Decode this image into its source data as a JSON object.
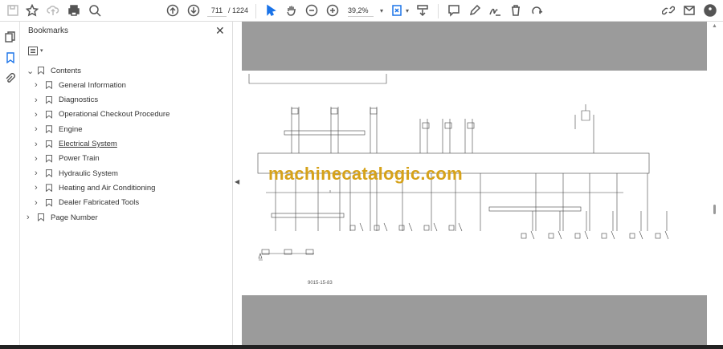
{
  "toolbar": {
    "icons": [
      "save-icon",
      "bookmark-star-icon",
      "upload-icon",
      "print-icon",
      "find-icon",
      "prev-page-icon",
      "next-page-icon",
      "select-cursor-icon",
      "hand-icon",
      "zoom-out-icon",
      "zoom-in-icon",
      "fit-page-icon",
      "scroll-mode-icon",
      "comment-icon",
      "pen-icon",
      "sign-icon",
      "delete-icon",
      "rotate-icon",
      "share-link-icon",
      "email-icon",
      "account-icon"
    ],
    "current_page": "711",
    "total_pages": "/ 1224",
    "zoom": "39,2%",
    "accent": "#1a73e8"
  },
  "panel": {
    "title": "Bookmarks",
    "items": [
      {
        "label": "Contents",
        "level": 0,
        "expanded": true
      },
      {
        "label": "General Information",
        "level": 1
      },
      {
        "label": "Diagnostics",
        "level": 1
      },
      {
        "label": "Operational Checkout Procedure",
        "level": 1
      },
      {
        "label": "Engine",
        "level": 1
      },
      {
        "label": "Electrical System",
        "level": 1,
        "underlined": true
      },
      {
        "label": "Power Train",
        "level": 1
      },
      {
        "label": "Hydraulic System",
        "level": 1
      },
      {
        "label": "Heating and Air Conditioning",
        "level": 1
      },
      {
        "label": "Dealer Fabricated Tools",
        "level": 1
      },
      {
        "label": "Page Number",
        "level": 0
      }
    ]
  },
  "document": {
    "watermark": "machinecatalogic.com",
    "page_footer": "9015-15-83"
  }
}
